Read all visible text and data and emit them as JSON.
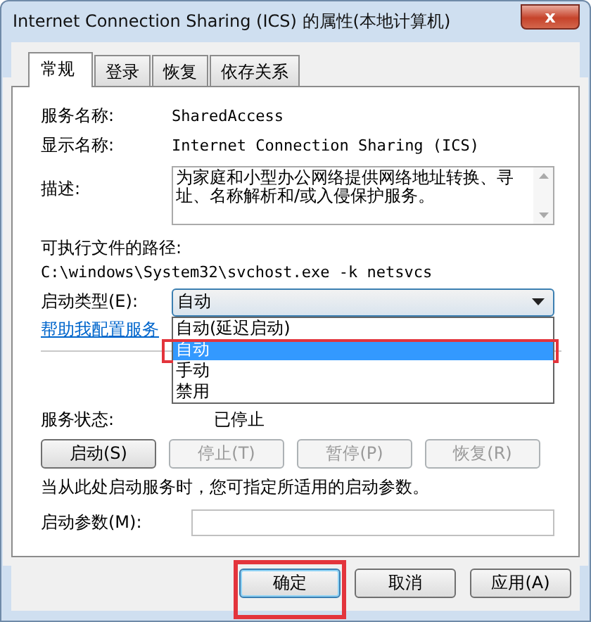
{
  "window": {
    "title": "Internet Connection Sharing (ICS) 的属性(本地计算机)",
    "close": "x"
  },
  "tabs": [
    {
      "label": "常规",
      "selected": true
    },
    {
      "label": "登录",
      "selected": false
    },
    {
      "label": "恢复",
      "selected": false
    },
    {
      "label": "依存关系",
      "selected": false
    }
  ],
  "fields": [
    {
      "label": "服务名称:",
      "value": "SharedAccess"
    },
    {
      "label": "显示名称:",
      "value": "Internet Connection Sharing (ICS)"
    }
  ],
  "description": {
    "label": "描述:",
    "value": "为家庭和小型办公网络提供网络地址转换、寻址、名称解析和/或入侵保护服务。"
  },
  "path": {
    "label": "可执行文件的路径:",
    "value": "C:\\windows\\System32\\svchost.exe -k netsvcs"
  },
  "startup_type": {
    "label": "启动类型(E):",
    "value": "自动",
    "expanded": true,
    "options": [
      {
        "label": "自动(延迟启动)",
        "selected": false,
        "highlighted": false
      },
      {
        "label": "自动",
        "selected": true,
        "highlighted": true
      },
      {
        "label": "手动",
        "selected": false,
        "highlighted": false
      },
      {
        "label": "禁用",
        "selected": false,
        "highlighted": false
      }
    ]
  },
  "help_link": "帮助我配置服务",
  "status": {
    "label": "服务状态:",
    "value": "已停止"
  },
  "service_buttons": [
    {
      "label": "启动(S)",
      "disabled": false
    },
    {
      "label": "停止(T)",
      "disabled": true
    },
    {
      "label": "暂停(P)",
      "disabled": true
    },
    {
      "label": "恢复(R)",
      "disabled": true
    }
  ],
  "hint": "当从此处启动服务时，您可指定所适用的启动参数。",
  "parameters": {
    "label": "启动参数(M):"
  },
  "dialog_buttons": [
    {
      "label": "确定",
      "highlighted": true
    },
    {
      "label": "取消",
      "highlighted": false
    },
    {
      "label": "应用(A)",
      "highlighted": false
    }
  ]
}
